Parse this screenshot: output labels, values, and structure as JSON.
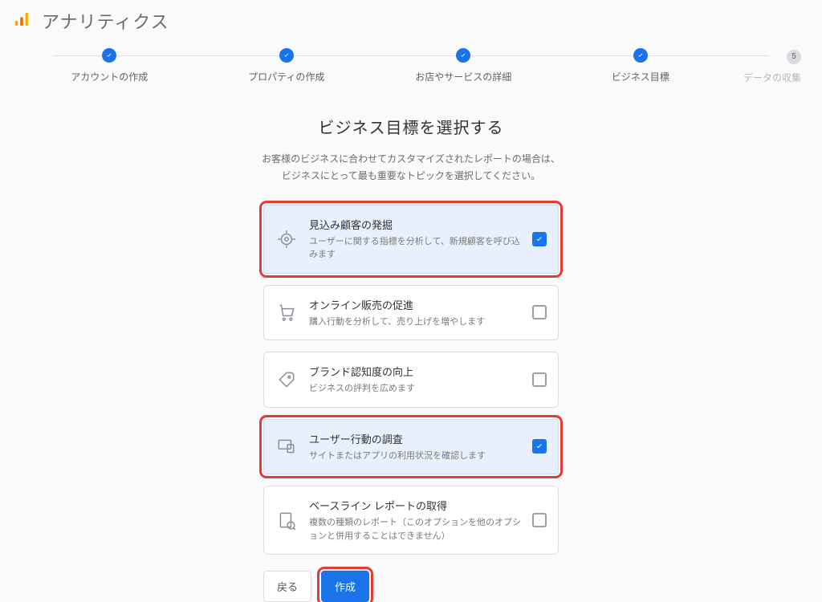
{
  "header": {
    "product_name": "アナリティクス"
  },
  "stepper": {
    "steps": [
      {
        "label": "アカウントの作成",
        "state": "done"
      },
      {
        "label": "プロパティの作成",
        "state": "done"
      },
      {
        "label": "お店やサービスの詳細",
        "state": "done"
      },
      {
        "label": "ビジネス目標",
        "state": "done"
      },
      {
        "label": "データの収集",
        "state": "pending",
        "number": "5"
      }
    ]
  },
  "main": {
    "title": "ビジネス目標を選択する",
    "subtitle_line1": "お客様のビジネスに合わせてカスタマイズされたレポートの場合は、",
    "subtitle_line2": "ビジネスにとって最も重要なトピックを選択してください。"
  },
  "cards": [
    {
      "title": "見込み顧客の発掘",
      "desc": "ユーザーに関する指標を分析して、新規顧客を呼び込みます",
      "checked": true,
      "highlight": true,
      "icon": "target"
    },
    {
      "title": "オンライン販売の促進",
      "desc": "購入行動を分析して、売り上げを増やします",
      "checked": false,
      "highlight": false,
      "icon": "cart"
    },
    {
      "title": "ブランド認知度の向上",
      "desc": "ビジネスの評判を広めます",
      "checked": false,
      "highlight": false,
      "icon": "tag"
    },
    {
      "title": "ユーザー行動の調査",
      "desc": "サイトまたはアプリの利用状況を確認します",
      "checked": true,
      "highlight": true,
      "icon": "devices"
    },
    {
      "title": "ベースライン レポートの取得",
      "desc": "複数の種類のレポート（このオプションを他のオプションと併用することはできません）",
      "checked": false,
      "highlight": false,
      "icon": "report"
    }
  ],
  "actions": {
    "back": "戻る",
    "create": "作成",
    "create_highlight": true
  }
}
